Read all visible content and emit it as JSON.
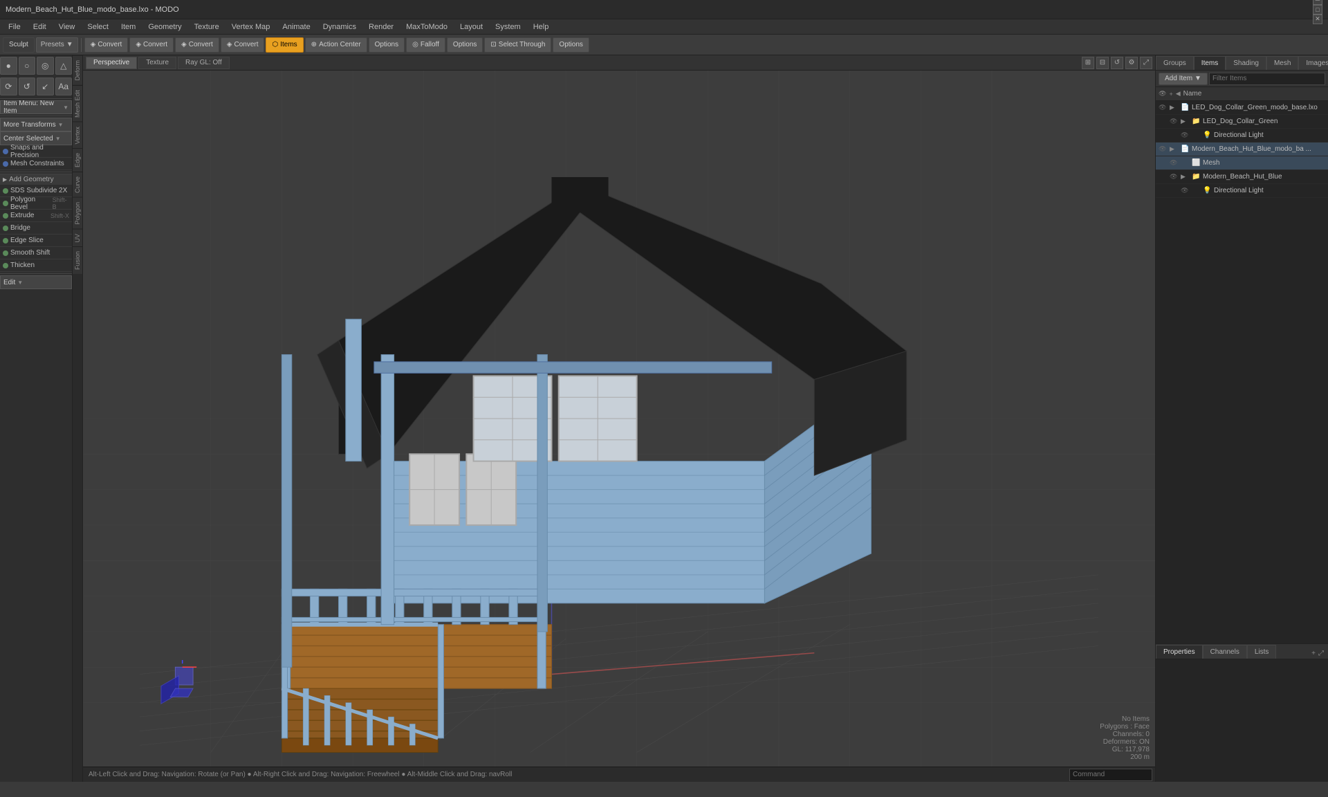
{
  "titlebar": {
    "title": "Modern_Beach_Hut_Blue_modo_base.lxo - MODO",
    "controls": [
      "minimize",
      "maximize",
      "close"
    ]
  },
  "menubar": {
    "items": [
      "File",
      "Edit",
      "View",
      "Select",
      "Item",
      "Geometry",
      "Texture",
      "Vertex Map",
      "Animate",
      "Dynamics",
      "Render",
      "MaxToModo",
      "Layout",
      "System",
      "Help"
    ]
  },
  "toolbar": {
    "sculpt_label": "Sculpt",
    "presets_label": "Presets",
    "convert_buttons": [
      "Convert",
      "Convert",
      "Convert",
      "Convert"
    ],
    "items_label": "Items",
    "action_center_label": "Action Center",
    "options_label1": "Options",
    "falloff_label": "Falloff",
    "options_label2": "Options",
    "select_through_label": "Select Through",
    "options_label3": "Options"
  },
  "left_panel": {
    "vtabs": [
      "Deform",
      "Mesh Edit",
      "Vertex",
      "Edge",
      "Curve",
      "Polygon",
      "UV",
      "Fusion"
    ],
    "icon_rows": [
      [
        "●",
        "○",
        "◎",
        "△"
      ],
      [
        "⟳",
        "↺",
        "↙",
        "Aa"
      ]
    ],
    "item_menu": "Item Menu: New Item",
    "more_transforms": "More Transforms",
    "center_selected": "Center Selected",
    "snaps_precision": "Snaps and Precision",
    "mesh_constraints": "Mesh Constraints",
    "add_geometry": "Add Geometry",
    "tools": [
      {
        "label": "SDS Subdivide 2X",
        "shortcut": "",
        "dot": "green"
      },
      {
        "label": "Polygon Bevel",
        "shortcut": "Shift-B",
        "dot": "green"
      },
      {
        "label": "Extrude",
        "shortcut": "Shift-X",
        "dot": "green"
      },
      {
        "label": "Bridge",
        "shortcut": "",
        "dot": "green"
      },
      {
        "label": "Edge Slice",
        "shortcut": "",
        "dot": "green"
      },
      {
        "label": "Smooth Shift",
        "shortcut": "",
        "dot": "green"
      },
      {
        "label": "Thicken",
        "shortcut": "",
        "dot": "green"
      }
    ],
    "edit_label": "Edit"
  },
  "viewport": {
    "tabs": [
      "Perspective",
      "Texture",
      "Ray GL: Off"
    ],
    "view_icons": [
      "⊞",
      "⊟",
      "↺",
      "⚙",
      "⤢"
    ]
  },
  "scene_objects": {
    "info": "No Items",
    "polygons": "Polygons : Face",
    "channels": "Channels: 0",
    "deformers": "Deformers: ON",
    "gl": "GL: 117,978",
    "size": "200 m"
  },
  "right_panel": {
    "tabs": [
      "Groups",
      "Items",
      "Shading",
      "Mesh",
      "Images"
    ],
    "add_item_label": "Add Item",
    "filter_placeholder": "Filter Items",
    "col_header": "Name",
    "items": [
      {
        "id": 1,
        "indent": 0,
        "icon": "📦",
        "name": "LED_Dog_Collar_Green_modo_base.lxo",
        "visible": true,
        "expanded": true
      },
      {
        "id": 2,
        "indent": 1,
        "icon": "▶",
        "name": "LED_Dog_Collar_Green",
        "visible": true,
        "expanded": false
      },
      {
        "id": 3,
        "indent": 2,
        "icon": "💡",
        "name": "Directional Light",
        "visible": true
      },
      {
        "id": 4,
        "indent": 0,
        "icon": "📦",
        "name": "Modern_Beach_Hut_Blue_modo_ba ...",
        "visible": true,
        "expanded": true,
        "selected": true
      },
      {
        "id": 5,
        "indent": 1,
        "icon": "⬛",
        "name": "Mesh",
        "visible": true,
        "selected": true
      },
      {
        "id": 6,
        "indent": 1,
        "icon": "▶",
        "name": "Modern_Beach_Hut_Blue",
        "visible": true
      },
      {
        "id": 7,
        "indent": 2,
        "icon": "💡",
        "name": "Directional Light",
        "visible": true
      }
    ],
    "bottom_tabs": [
      "Properties",
      "Channels",
      "Lists"
    ],
    "bottom_add_btn": "+"
  },
  "statusbar": {
    "left_text": "Alt-Left Click and Drag: Navigation: Rotate (or Pan)   ●  Alt-Right Click and Drag: Navigation: Freewheel   ●  Alt-Middle Click and Drag: navRoll",
    "command_placeholder": "Command"
  }
}
